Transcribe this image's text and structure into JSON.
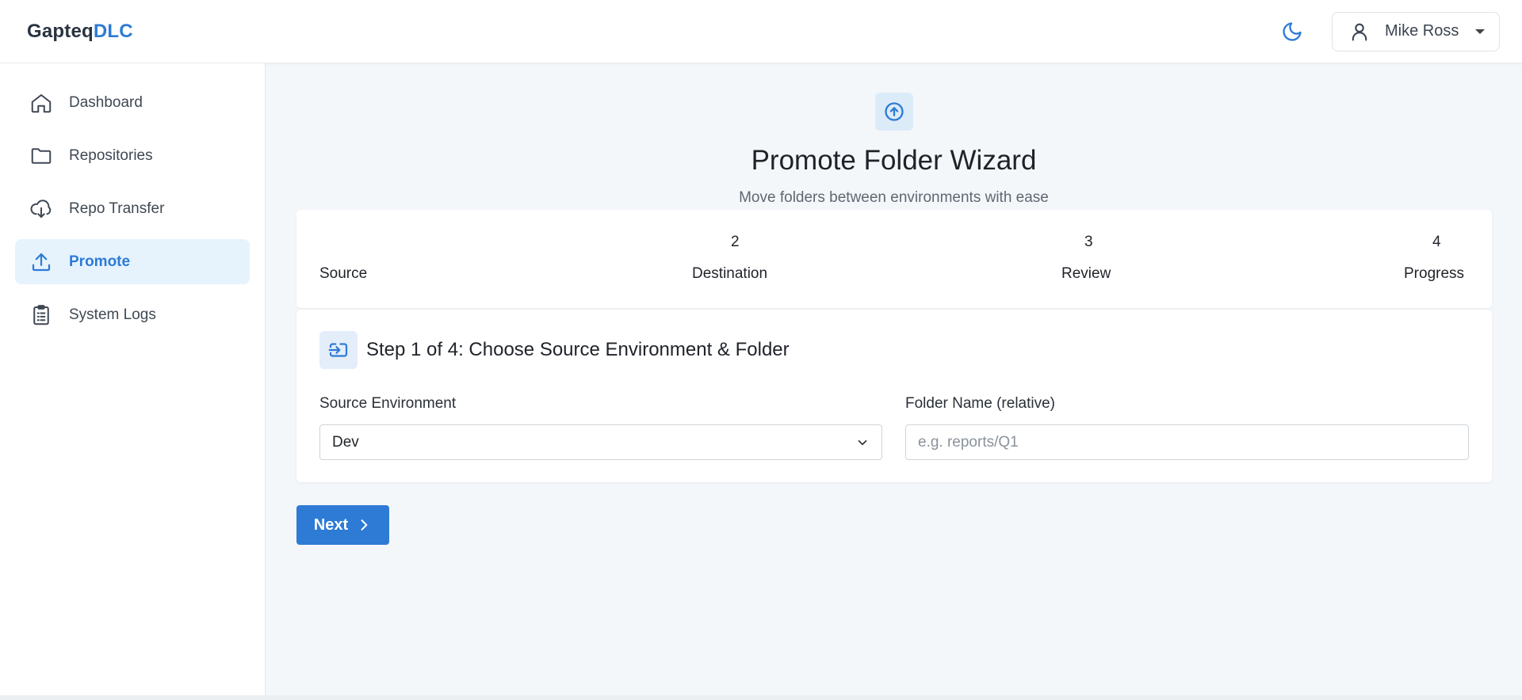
{
  "brand": {
    "part1": "Gapteq",
    "part2": "DLC"
  },
  "header": {
    "user_name": "Mike Ross"
  },
  "sidebar": {
    "items": [
      {
        "label": "Dashboard"
      },
      {
        "label": "Repositories"
      },
      {
        "label": "Repo Transfer"
      },
      {
        "label": "Promote"
      },
      {
        "label": "System Logs"
      }
    ]
  },
  "wizard": {
    "title": "Promote Folder Wizard",
    "subtitle": "Move folders between environments with ease",
    "steps": [
      {
        "number": "",
        "label": "Source"
      },
      {
        "number": "2",
        "label": "Destination"
      },
      {
        "number": "3",
        "label": "Review"
      },
      {
        "number": "4",
        "label": "Progress"
      }
    ],
    "card_title": "Step 1 of 4: Choose Source Environment & Folder",
    "source_env_label": "Source Environment",
    "source_env_value": "Dev",
    "folder_label": "Folder Name (relative)",
    "folder_placeholder": "e.g. reports/Q1",
    "folder_value": "",
    "next_label": "Next"
  },
  "colors": {
    "accent": "#2d7bd5",
    "active_bg": "#e6f3fd",
    "page_bg": "#f4f7fa"
  },
  "icons": {
    "theme": "moon-icon",
    "user": "user-icon",
    "hero": "arrow-up-circle-icon",
    "card": "folder-import-icon",
    "next": "chevron-right-icon"
  }
}
